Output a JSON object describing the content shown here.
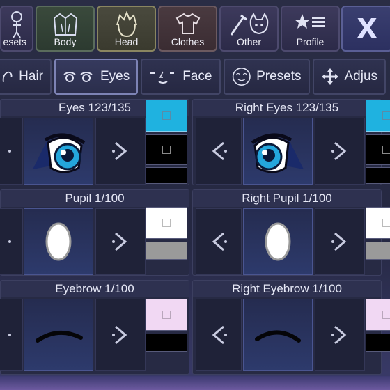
{
  "categories": [
    {
      "label": "esets",
      "icon": "figure-icon"
    },
    {
      "label": "Body",
      "icon": "jacket-icon"
    },
    {
      "label": "Head",
      "icon": "hair-head-icon"
    },
    {
      "label": "Clothes",
      "icon": "shirt-icon"
    },
    {
      "label": "Other",
      "icon": "sword-cat-icon"
    },
    {
      "label": "Profile",
      "icon": "star-list-icon"
    }
  ],
  "close_label": "X",
  "subtabs": [
    {
      "label": "Hair",
      "icon": "hair-icon"
    },
    {
      "label": "Eyes",
      "icon": "eyes-icon"
    },
    {
      "label": "Face",
      "icon": "face-icon"
    },
    {
      "label": "Presets",
      "icon": "face-circle-icon"
    },
    {
      "label": "Adjus",
      "icon": "move-arrows-icon"
    }
  ],
  "panels": {
    "eyes": {
      "title": "Eyes 123/135"
    },
    "right_eyes": {
      "title": "Right Eyes 123/135"
    },
    "pupil": {
      "title": "Pupil 1/100"
    },
    "right_pupil": {
      "title": "Right Pupil 1/100"
    },
    "eyebrow": {
      "title": "Eyebrow 1/100"
    },
    "right_eyebrow": {
      "title": "Right Eyebrow 1/100"
    }
  },
  "colors": {
    "eye_primary": "#1fb2e0",
    "eye_secondary": "#000000",
    "pupil_primary": "#ffffff",
    "pupil_secondary": "#9a9a9a",
    "brow_primary": "#f1d8f3",
    "brow_secondary": "#000000"
  }
}
